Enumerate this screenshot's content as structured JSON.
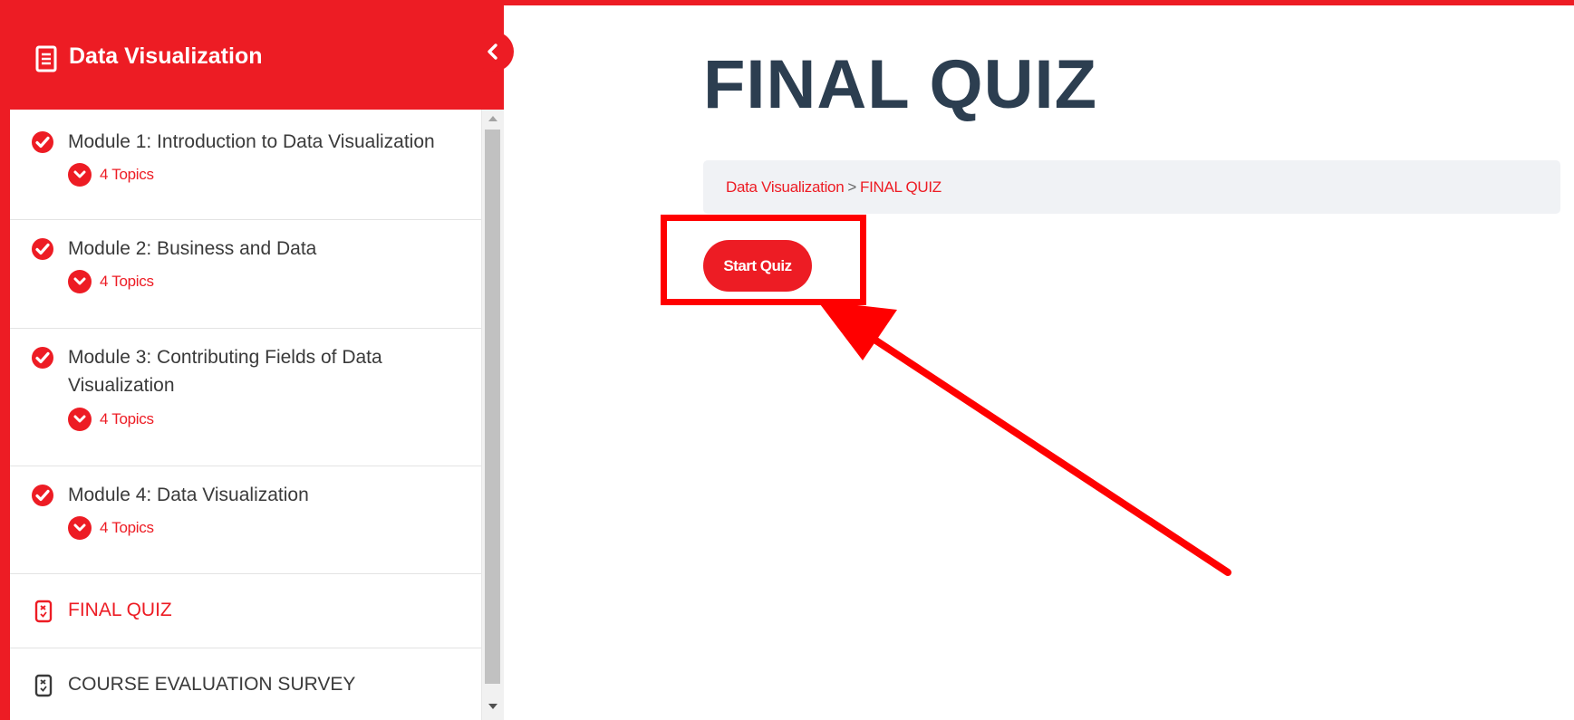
{
  "sidebar": {
    "title": "Data Visualization",
    "modules": [
      {
        "title": "Module 1: Introduction to Data Visualization",
        "topics": "4 Topics"
      },
      {
        "title": "Module 2: Business and Data",
        "topics": "4 Topics"
      },
      {
        "title": "Module 3: Contributing Fields of Data Visualization",
        "topics": "4 Topics"
      },
      {
        "title": "Module 4: Data Visualization",
        "topics": "4 Topics"
      }
    ],
    "quizzes": [
      {
        "label": "FINAL QUIZ",
        "active": true
      },
      {
        "label": "COURSE EVALUATION SURVEY",
        "active": false
      }
    ]
  },
  "main": {
    "title": "FINAL QUIZ",
    "breadcrumb": {
      "course": "Data Visualization",
      "separator": ">",
      "current": "FINAL QUIZ"
    },
    "start_button": "Start Quiz"
  },
  "colors": {
    "accent": "#ed1c24",
    "title": "#2c3e50",
    "annotation": "#ff0000"
  }
}
